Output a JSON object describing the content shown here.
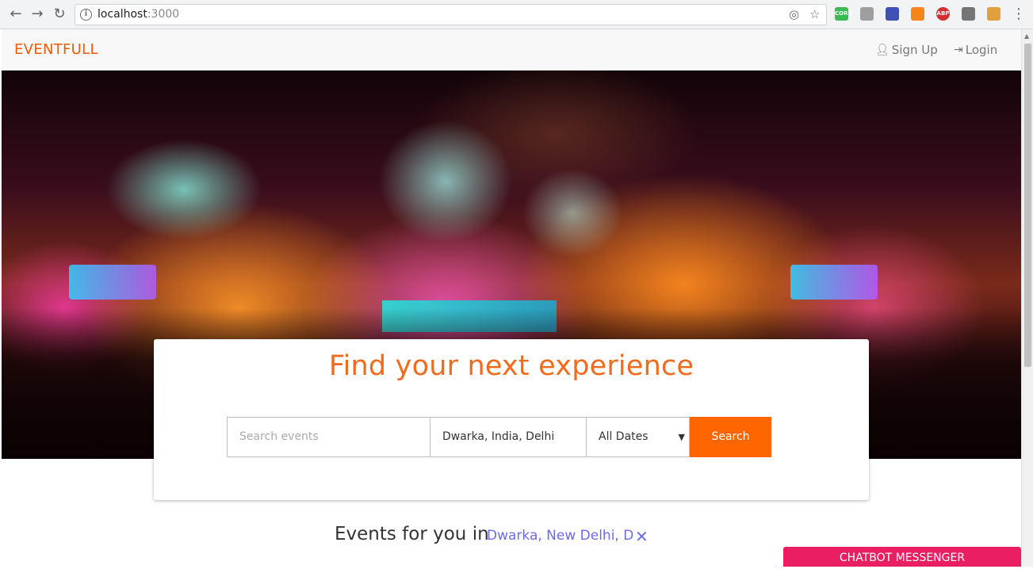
{
  "browser": {
    "url_host": "localhost",
    "url_port": ":3000",
    "back_icon": "arrow-left-icon",
    "forward_icon": "arrow-right-icon",
    "reload_icon": "reload-icon",
    "extensions": [
      {
        "name": "cors-extension-icon",
        "label": "CORS",
        "color": "#3cba54"
      },
      {
        "name": "screen-extension-icon",
        "label": "",
        "color": "#9e9e9e"
      },
      {
        "name": "dropper-extension-icon",
        "label": "",
        "color": "#3f51b5"
      },
      {
        "name": "fox-extension-icon",
        "label": "",
        "color": "#f6851b"
      },
      {
        "name": "adblock-extension-icon",
        "label": "ABP",
        "color": "#d32f2f"
      },
      {
        "name": "circle-extension-icon",
        "label": "",
        "color": "#757575"
      },
      {
        "name": "cookie-extension-icon",
        "label": "",
        "color": "#e0a03c"
      }
    ]
  },
  "nav": {
    "brand": "EVENTFULL",
    "signup_label": "Sign Up",
    "login_label": "Login"
  },
  "hero": {
    "heading": "Find your next experience",
    "search": {
      "placeholder": "Search events",
      "location_value": "Dwarka, India, Delhi",
      "date_value": "All Dates",
      "button_label": "Search"
    }
  },
  "events": {
    "prefix": "Events for you in",
    "location": "Dwarka, New Delhi, D"
  },
  "chatbot": {
    "label": "CHATBOT MESSENGER"
  },
  "colors": {
    "brand": "#f05a00",
    "search_button": "#ff6600",
    "chatbot": "#e91e63",
    "link": "#6b6bea"
  }
}
